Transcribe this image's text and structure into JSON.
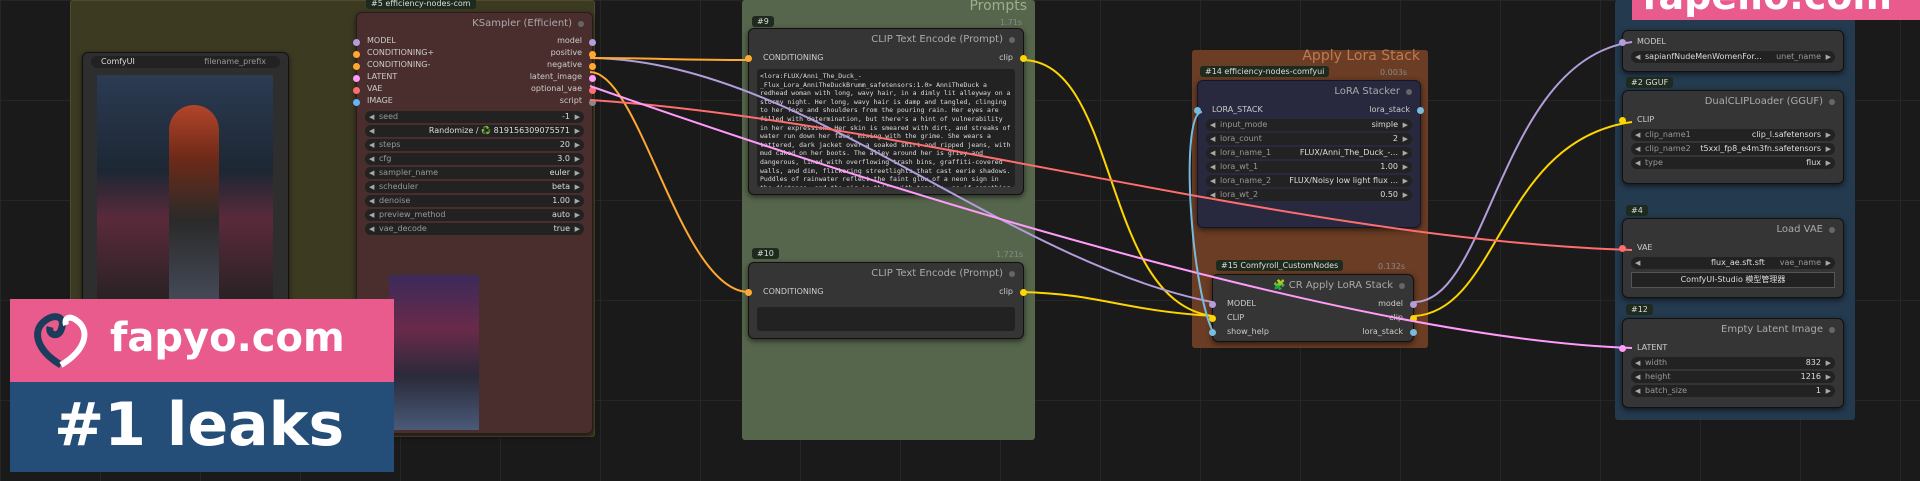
{
  "groups": {
    "prompts_title": "Prompts",
    "lora_title": "Apply Lora Stack",
    "top_right_text": "fapello.com"
  },
  "ksampler": {
    "badge": "#5 efficiency-nodes-com",
    "title": "KSampler (Efficient)",
    "inputs": [
      "model",
      "positive",
      "negative",
      "latent_image",
      "optional_vae",
      "script"
    ],
    "outputs": [
      "MODEL",
      "CONDITIONING+",
      "CONDITIONING-",
      "LATENT",
      "VAE",
      "IMAGE"
    ],
    "widgets": [
      {
        "label": "seed",
        "value": "-1"
      },
      {
        "label": "",
        "value": "Randomize / ♻️ 819156309075571"
      },
      {
        "label": "steps",
        "value": "20"
      },
      {
        "label": "cfg",
        "value": "3.0"
      },
      {
        "label": "sampler_name",
        "value": "euler"
      },
      {
        "label": "scheduler",
        "value": "beta"
      },
      {
        "label": "denoise",
        "value": "1.00"
      },
      {
        "label": "preview_method",
        "value": "auto"
      },
      {
        "label": "vae_decode",
        "value": "true"
      }
    ]
  },
  "save_image": {
    "prefix_label": "filename_prefix",
    "prefix_value": "ComfyUI"
  },
  "clip_pos": {
    "badge": "#9",
    "ver": "1.71s",
    "title": "CLIP Text Encode (Prompt)",
    "input": "clip",
    "output": "CONDITIONING",
    "text": "<lora:FLUX/Anni_The_Duck_-_Flux_Lora_AnniTheDuckBrumm_safetensors:1.0> AnniTheDuck a redhead woman with long, wavy hair, in a dimly lit alleyway on a stormy night. Her long, wavy hair is damp and tangled, clinging to her face and shoulders from the pouring rain. Her eyes are filled with determination, but there's a hint of vulnerability in her expression. Her skin is smeared with dirt, and streaks of water run down her face, mixing with the grime. She wears a tattered, dark jacket over a soaked shirt and ripped jeans, with mud caked on her boots. The alley around her is grimy and dangerous, lined with overflowing trash bins, graffiti-covered walls, and dim, flickering streetlights that cast eerie shadows. Puddles of rainwater reflect the faint glow of a neon sign in the distance, and the air is thick with tension, as if something menacing lurks just out of sight. Despite the harshness of the environment, she stands tall, ready to face whatever danger awaits her. The image is very dark, no light on the model. The pixelated quality and natural shadows from the dim, fluorescent lighting give a raw, unfiltered look. low light, noise, grain, jpeg artifacts. DSC_0001.jpeg. A low-quality low light 2015 Snapshot photo."
  },
  "clip_neg": {
    "badge": "#10",
    "ver": "1.721s",
    "title": "CLIP Text Encode (Prompt)",
    "input": "clip",
    "output": "CONDITIONING"
  },
  "lora_stacker": {
    "badge": "#14 efficiency-nodes-comfyui",
    "ver": "0.003s",
    "title": "LoRA Stacker",
    "input": "lora_stack",
    "output": "LORA_STACK",
    "widgets": [
      {
        "label": "input_mode",
        "value": "simple"
      },
      {
        "label": "lora_count",
        "value": "2"
      },
      {
        "label": "lora_name_1",
        "value": "FLUX/Anni_The_Duck_-..."
      },
      {
        "label": "lora_wt_1",
        "value": "1.00"
      },
      {
        "label": "lora_name_2",
        "value": "FLUX/Noisy low light flux ..."
      },
      {
        "label": "lora_wt_2",
        "value": "0.50"
      }
    ]
  },
  "cr_apply": {
    "badge": "#15 Comfyroll_CustomNodes",
    "ver": "0.132s",
    "title": "🧩 CR Apply LoRA Stack",
    "inputs": [
      "MODEL",
      "CLIP",
      "show_help"
    ],
    "outputs": [
      "model",
      "clip",
      "lora_stack"
    ]
  },
  "unet": {
    "output": "MODEL",
    "widget": {
      "label": "unet_name",
      "value": "sapianfNudeMenWomenFor..."
    }
  },
  "dualclip": {
    "badge": "#2 GGUF",
    "title": "DualCLIPLoader (GGUF)",
    "output": "CLIP",
    "widgets": [
      {
        "label": "clip_name1",
        "value": "clip_l.safetensors"
      },
      {
        "label": "clip_name2",
        "value": "t5xxl_fp8_e4m3fn.safetensors"
      },
      {
        "label": "type",
        "value": "flux"
      }
    ]
  },
  "vae": {
    "badge": "#4",
    "title": "Load VAE",
    "output": "VAE",
    "widget": {
      "label": "vae_name",
      "value": "flux_ae.sft.sft"
    },
    "button": "ComfyUI-Studio 模型管理器"
  },
  "latent": {
    "badge": "#12",
    "title": "Empty Latent Image",
    "output": "LATENT",
    "widgets": [
      {
        "label": "width",
        "value": "832"
      },
      {
        "label": "height",
        "value": "1216"
      },
      {
        "label": "batch_size",
        "value": "1"
      }
    ]
  },
  "watermark": {
    "site": "fapyo.com",
    "tagline": "#1 leaks"
  }
}
